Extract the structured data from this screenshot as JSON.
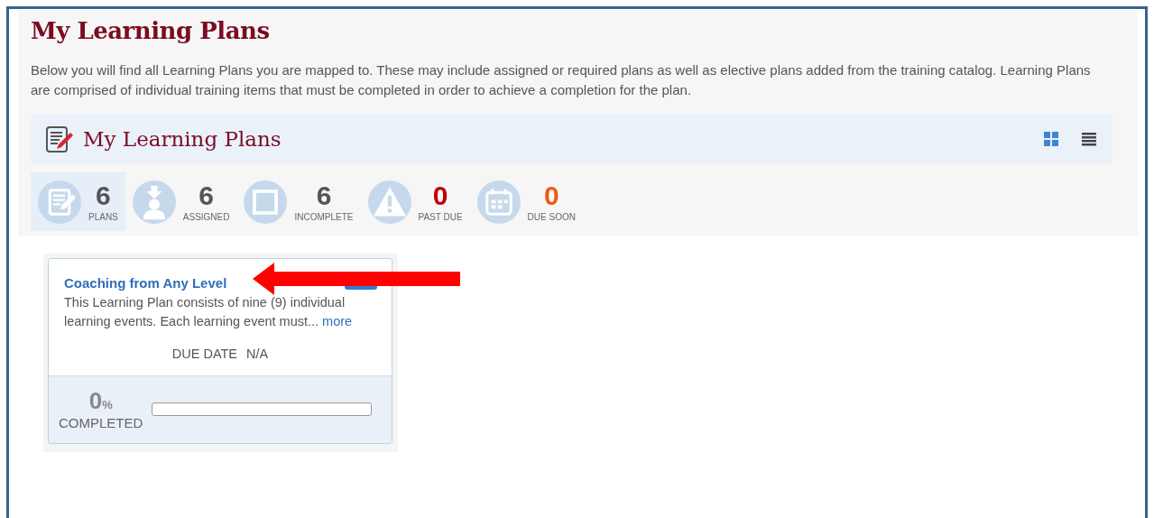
{
  "page": {
    "title": "My Learning Plans",
    "description": "Below you will find all Learning Plans you are mapped to. These may include assigned or required plans as well as elective plans added from the training catalog. Learning Plans are comprised of individual training items that must be completed in order to achieve a completion for the plan."
  },
  "header": {
    "title": "My Learning Plans",
    "view_buttons": [
      {
        "kind": "grid",
        "selected": true
      },
      {
        "kind": "list",
        "selected": false
      }
    ]
  },
  "stats": [
    {
      "kind": "plans",
      "count": "6",
      "label": "PLANS",
      "color": "#555555",
      "selected": true
    },
    {
      "kind": "assigned",
      "count": "6",
      "label": "ASSIGNED",
      "color": "#555555",
      "selected": false
    },
    {
      "kind": "incomplete",
      "count": "6",
      "label": "INCOMPLETE",
      "color": "#555555",
      "selected": false
    },
    {
      "kind": "past_due",
      "count": "0",
      "label": "PAST DUE",
      "color": "#c00000",
      "selected": false
    },
    {
      "kind": "due_soon",
      "count": "0",
      "label": "DUE SOON",
      "color": "#f05a14",
      "selected": false
    }
  ],
  "plans": [
    {
      "title": "Coaching from Any Level",
      "summary": "This Learning Plan consists of nine (9) individual learning events. Each learning event must...",
      "more_link": "more",
      "due_label": "DUE DATE",
      "due_value": "N/A",
      "percent": "0",
      "percent_sign": "%",
      "completed_label": "COMPLETED",
      "level": 0
    }
  ],
  "annotation": {
    "kind": "arrow",
    "color": "#ff0000"
  }
}
